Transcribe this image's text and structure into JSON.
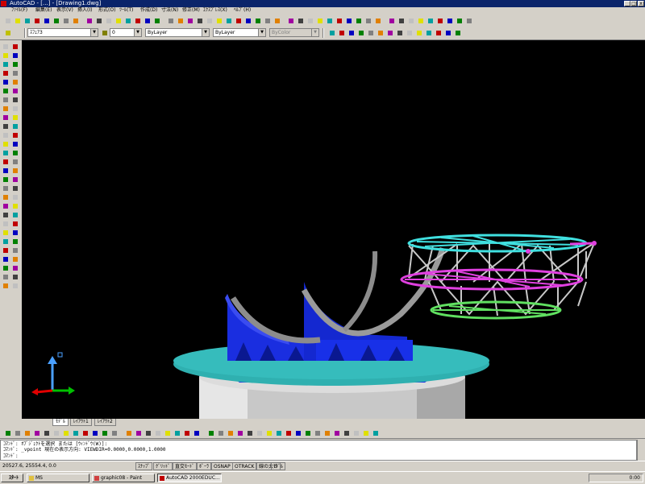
{
  "window": {
    "title": "AutoCAD - [...] - [Drawing1.dwg]",
    "minimize": "_",
    "maximize": "□",
    "close": "x"
  },
  "menubar": {
    "items": [
      "ﾌｧｲﾙ(F)",
      "編集(E)",
      "表示(V)",
      "挿入(I)",
      "形式(O)",
      "ﾂｰﾙ(T)",
      "作成(D)",
      "寸法(N)",
      "修正(M)",
      "ｴｸｽﾌﾟﾚｽ(X)",
      "ﾍﾙﾌﾟ(H)"
    ]
  },
  "layer_toolbar": {
    "layer_value": "ｽﾌｪｱ3",
    "color_value": "0",
    "linetype_value": "ByLayer",
    "lineweight_value": "ByLayer",
    "plotstyle_value": "ByColor"
  },
  "viewport": {
    "background": "#000000",
    "colors": {
      "disc": "#2fb0b0",
      "blue_structure": "#1a2ee0",
      "arc": "#8c8c8c",
      "cylinder": "#dcdcdc",
      "truss_top": "#40e0e0",
      "truss_mid": "#e040e0",
      "truss_bottom": "#60e060",
      "truss_member": "#c8c8c8"
    }
  },
  "tabs": [
    "ﾓﾃﾞﾙ",
    "ﾚｲｱｳﾄ1",
    "ﾚｲｱｳﾄ2"
  ],
  "command": {
    "line1": "ｺﾏﾝﾄﾞ: ｵﾌﾞｼﾞｪｸﾄを選択 または [ｳｨﾝﾄﾞｳ(W)]:",
    "line2": "ｺﾏﾝﾄﾞ: _vpoint 現在の表示方向: VIEWDIR=0.0000,0.0000,1.0000",
    "line3": "ｺﾏﾝﾄﾞ:"
  },
  "status": {
    "coords": "20527.6, 25554.4, 0.0",
    "buttons": [
      "ｽﾅｯﾌﾟ",
      "ｸﾞﾘｯﾄﾞ",
      "直交ﾓｰﾄﾞ",
      "ﾎﾟｰﾗ",
      "OSNAP",
      "OTRACK",
      "線の太さ",
      "ﾓﾃﾞﾙ"
    ]
  },
  "taskbar": {
    "start": "ｽﾀｰﾄ",
    "tasks": [
      "MS",
      "graphic08 - Paint",
      "AutoCAD 2000EDUC..."
    ],
    "clock": "0:00"
  }
}
